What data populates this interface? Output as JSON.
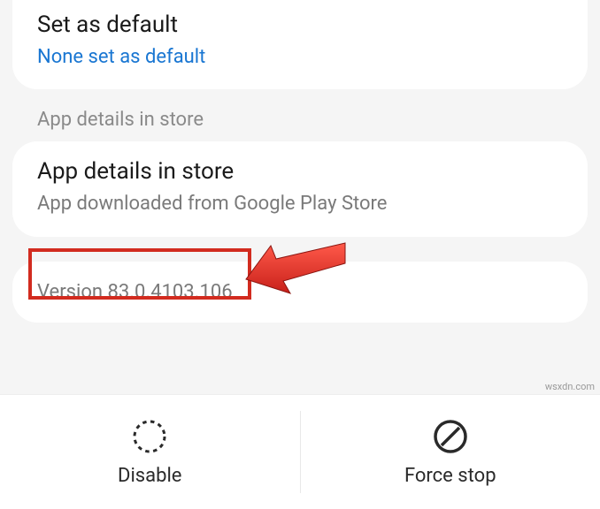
{
  "set_default": {
    "title": "Set as default",
    "subtitle": "None set as default"
  },
  "section_header": "App details in store",
  "app_details": {
    "title": "App details in store",
    "subtitle": "App downloaded from Google Play Store"
  },
  "version": {
    "text": "Version 83.0.4103.106"
  },
  "buttons": {
    "disable": "Disable",
    "force_stop": "Force stop"
  },
  "watermark": "wsxdn.com",
  "colors": {
    "link": "#1976d2",
    "highlight": "#d22b1f"
  }
}
